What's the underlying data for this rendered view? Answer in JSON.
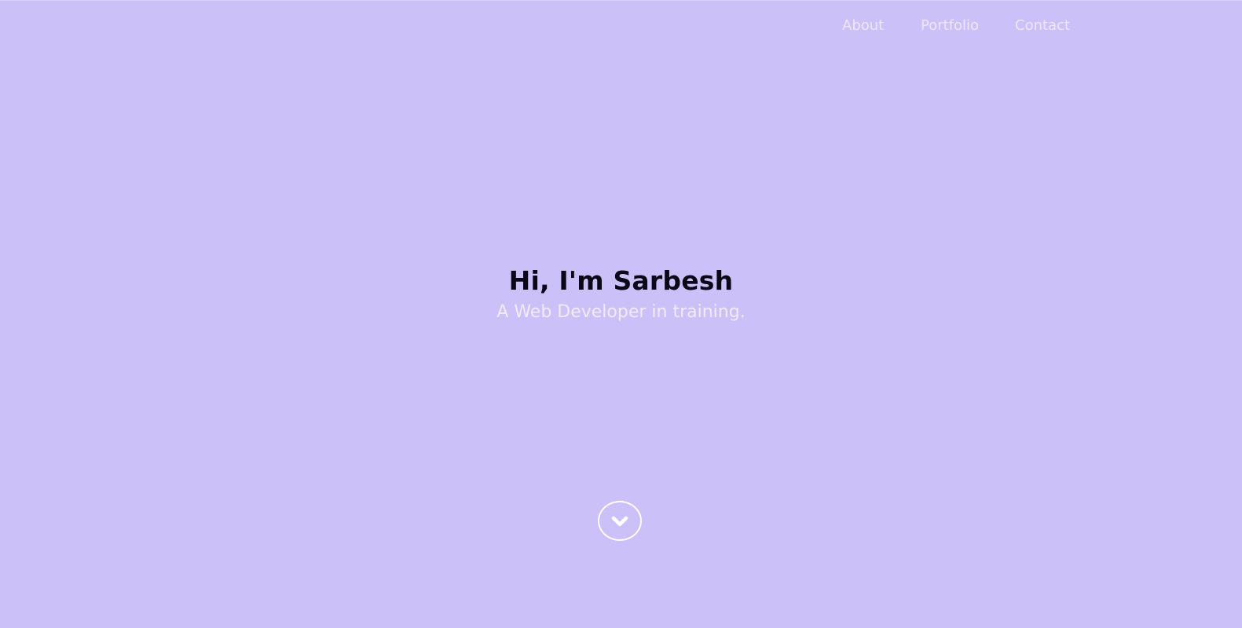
{
  "nav": {
    "items": [
      {
        "label": "About"
      },
      {
        "label": "Portfolio"
      },
      {
        "label": "Contact"
      }
    ]
  },
  "hero": {
    "title": "Hi, I'm Sarbesh",
    "subtitle": "A Web Developer in training."
  },
  "scroll_button": {
    "icon": "chevron-down-icon"
  },
  "colors": {
    "background": "#cbc0f7",
    "nav_text": "#ede8fb",
    "title_text": "#0a0716",
    "subtitle_text": "#efecfb",
    "button_outline": "#ffffff"
  }
}
